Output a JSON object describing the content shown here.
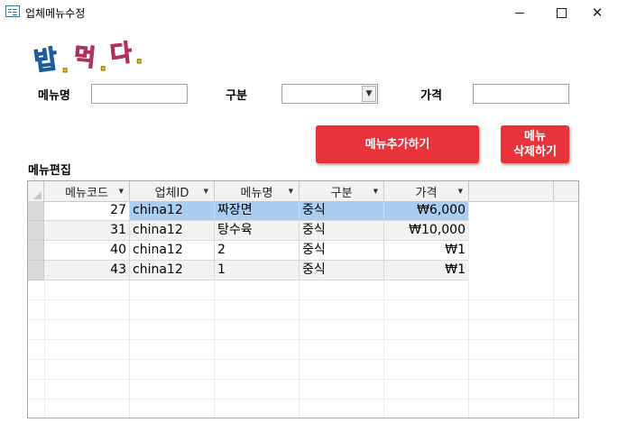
{
  "window": {
    "title": "업체메뉴수정",
    "minimize_icon": "minimize-icon",
    "maximize_icon": "maximize-icon",
    "close_icon": "close-icon"
  },
  "logo": {
    "text": [
      "밥",
      ".",
      "먹",
      ".",
      "다",
      "."
    ]
  },
  "form": {
    "menu_label": "메뉴명",
    "menu_value": "",
    "category_label": "구분",
    "category_value": "",
    "price_label": "가격",
    "price_value": ""
  },
  "buttons": {
    "add_label": "메뉴추가하기",
    "delete_label_line1": "메뉴",
    "delete_label_line2": "삭제하기",
    "accent_color": "#e8333b"
  },
  "section_title": "메뉴편집",
  "table": {
    "columns": [
      "메뉴코드",
      "업체ID",
      "메뉴명",
      "구분",
      "가격"
    ],
    "rows": [
      {
        "code": "27",
        "vendor": "china12",
        "name": "짜장면",
        "category": "중식",
        "price": "₩6,000"
      },
      {
        "code": "31",
        "vendor": "china12",
        "name": "탕수육",
        "category": "중식",
        "price": "₩10,000"
      },
      {
        "code": "40",
        "vendor": "china12",
        "name": "2",
        "category": "중식",
        "price": "₩1"
      },
      {
        "code": "43",
        "vendor": "china12",
        "name": "1",
        "category": "중식",
        "price": "₩1"
      }
    ],
    "selected_color": "#a9cef2"
  }
}
